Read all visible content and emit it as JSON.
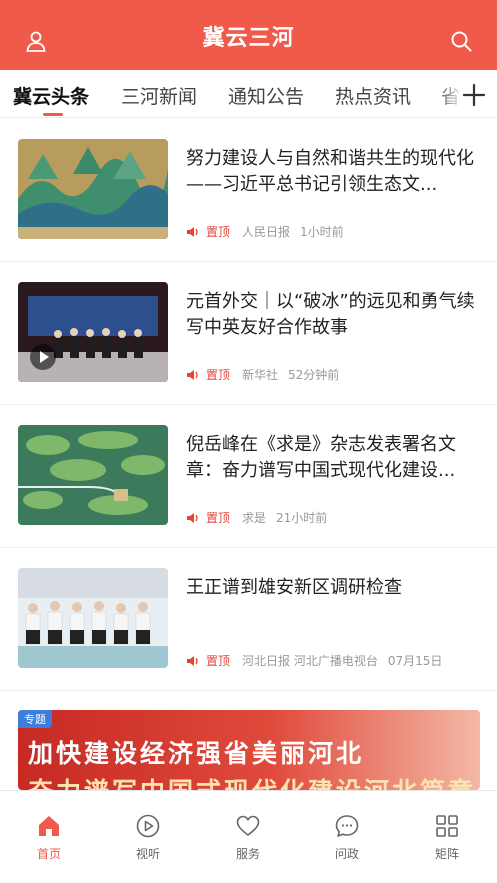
{
  "header": {
    "title": "冀云三河"
  },
  "tabs": [
    {
      "label": "冀云头条"
    },
    {
      "label": "三河新闻"
    },
    {
      "label": "通知公告"
    },
    {
      "label": "热点资讯"
    },
    {
      "label": "省"
    }
  ],
  "news": [
    {
      "title": "努力建设人与自然和谐共生的现代化——习近平总书记引领生态文...",
      "pin": "置顶",
      "source": "人民日报",
      "time": "1小时前"
    },
    {
      "title": "元首外交｜以“破冰”的远见和勇气续写中英友好合作故事",
      "pin": "置顶",
      "source": "新华社",
      "time": "52分钟前"
    },
    {
      "title": "倪岳峰在《求是》杂志发表署名文章：奋力谱写中国式现代化建设...",
      "pin": "置顶",
      "source": "求是",
      "time": "21小时前"
    },
    {
      "title": "王正谱到雄安新区调研检查",
      "pin": "置顶",
      "source": "河北日报 河北广播电视台",
      "time": "07月15日"
    }
  ],
  "banner": {
    "tag": "专题",
    "line1": "加快建设经济强省美丽河北",
    "line2": "奋力谱写中国式现代化建设河北篇章"
  },
  "tabbar": [
    {
      "label": "首页",
      "icon": "home-icon"
    },
    {
      "label": "视听",
      "icon": "play-circle-icon"
    },
    {
      "label": "服务",
      "icon": "heart-icon"
    },
    {
      "label": "问政",
      "icon": "chat-icon"
    },
    {
      "label": "矩阵",
      "icon": "grid-icon"
    }
  ],
  "colors": {
    "brand": "#f05a4b",
    "pin": "#e2463a",
    "banner_tag": "#3e7de0"
  }
}
